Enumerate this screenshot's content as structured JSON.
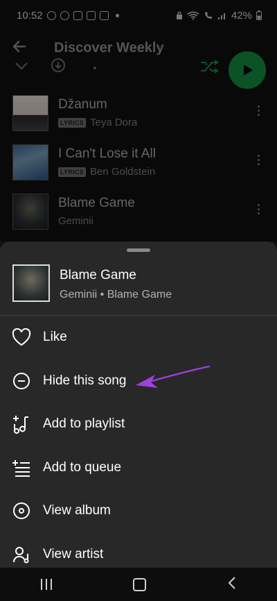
{
  "status_bar": {
    "time": "10:52",
    "battery": "42%"
  },
  "header": {
    "title": "Discover Weekly"
  },
  "playlist_tracks": [
    {
      "title": "Džanum",
      "artist": "Teya Dora",
      "lyrics_badge": "LYRICS"
    },
    {
      "title": "I Can't Lose it All",
      "artist": "Ben Goldstein",
      "lyrics_badge": "LYRICS"
    },
    {
      "title": "Blame Game",
      "artist": "Geminii"
    }
  ],
  "sheet": {
    "track": {
      "title": "Blame Game",
      "subtitle": "Geminii • Blame Game"
    },
    "menu": [
      {
        "label": "Like",
        "icon": "heart-icon"
      },
      {
        "label": "Hide this song",
        "icon": "minus-circle-icon"
      },
      {
        "label": "Add to playlist",
        "icon": "add-to-playlist-icon"
      },
      {
        "label": "Add to queue",
        "icon": "add-to-queue-icon"
      },
      {
        "label": "View album",
        "icon": "album-icon"
      },
      {
        "label": "View artist",
        "icon": "artist-icon"
      }
    ]
  },
  "colors": {
    "accent": "#1ed760",
    "annotation_arrow": "#a040e0",
    "sheet_bg": "#282828"
  }
}
